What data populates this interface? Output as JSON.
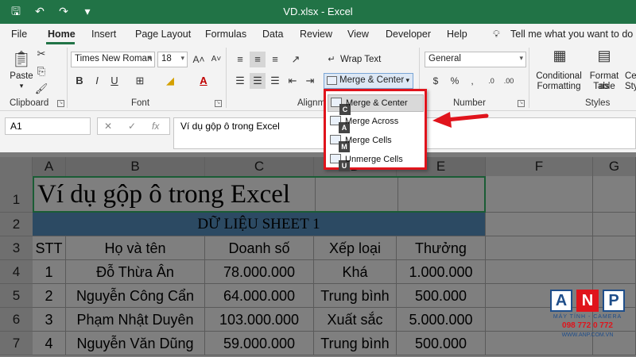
{
  "titlebar": {
    "title": "VD.xlsx - Excel"
  },
  "tabs": [
    "File",
    "Home",
    "Insert",
    "Page Layout",
    "Formulas",
    "Data",
    "Review",
    "View",
    "Developer",
    "Help"
  ],
  "tell_me": "Tell me what you want to do",
  "clipboard": {
    "paste": "Paste",
    "label": "Clipboard"
  },
  "font": {
    "name": "Times New Roman",
    "size": "18",
    "label": "Font",
    "bold": "B",
    "italic": "I",
    "underline": "U",
    "font_color": "A"
  },
  "alignment": {
    "label": "Alignm",
    "wrap": "Wrap Text",
    "merge": "Merge & Center"
  },
  "number": {
    "format": "General",
    "label": "Number"
  },
  "styles": {
    "cond": [
      "Conditional",
      "Formatting"
    ],
    "table": [
      "Format as",
      "Table"
    ],
    "cell": [
      "Cell",
      "Sty"
    ],
    "label": "Styles"
  },
  "formula_bar": {
    "name_box": "A1",
    "fx": "fx",
    "content": "Ví dụ gộp ô trong Excel"
  },
  "merge_menu": [
    {
      "key": "C",
      "label": "Merge & Center"
    },
    {
      "key": "A",
      "label": "Merge Across"
    },
    {
      "key": "M",
      "label": "Merge Cells"
    },
    {
      "key": "U",
      "label": "Unmerge Cells"
    }
  ],
  "sheet": {
    "columns": [
      "A",
      "B",
      "C",
      "D",
      "E",
      "F",
      "G"
    ],
    "rows": [
      "1",
      "2",
      "3",
      "4",
      "5",
      "6",
      "7"
    ],
    "title": "Ví dụ gộp ô trong Excel",
    "subtitle": "DỮ LIỆU SHEET 1",
    "headers": [
      "STT",
      "Họ và tên",
      "Doanh số",
      "Xếp loại",
      "Thưởng"
    ],
    "data": [
      [
        "1",
        "Đỗ Thừa Ân",
        "78.000.000",
        "Khá",
        "1.000.000"
      ],
      [
        "2",
        "Nguyễn Công Cẩn",
        "64.000.000",
        "Trung bình",
        "500.000"
      ],
      [
        "3",
        "Phạm Nhật Duyên",
        "103.000.000",
        "Xuất sắc",
        "5.000.000"
      ],
      [
        "4",
        "Nguyễn Văn Dũng",
        "59.000.000",
        "Trung bình",
        "500.000"
      ]
    ]
  },
  "logo": {
    "letters": [
      "A",
      "N",
      "P"
    ],
    "line1": "MÁY TÍNH - CAMERA",
    "line2": "098 772 0 772",
    "line3": "WWW.ANP.COM.VN"
  },
  "colors": {
    "excel_green": "#217346",
    "highlight_red": "#e0141c",
    "header_blue": "#2e75b6"
  }
}
